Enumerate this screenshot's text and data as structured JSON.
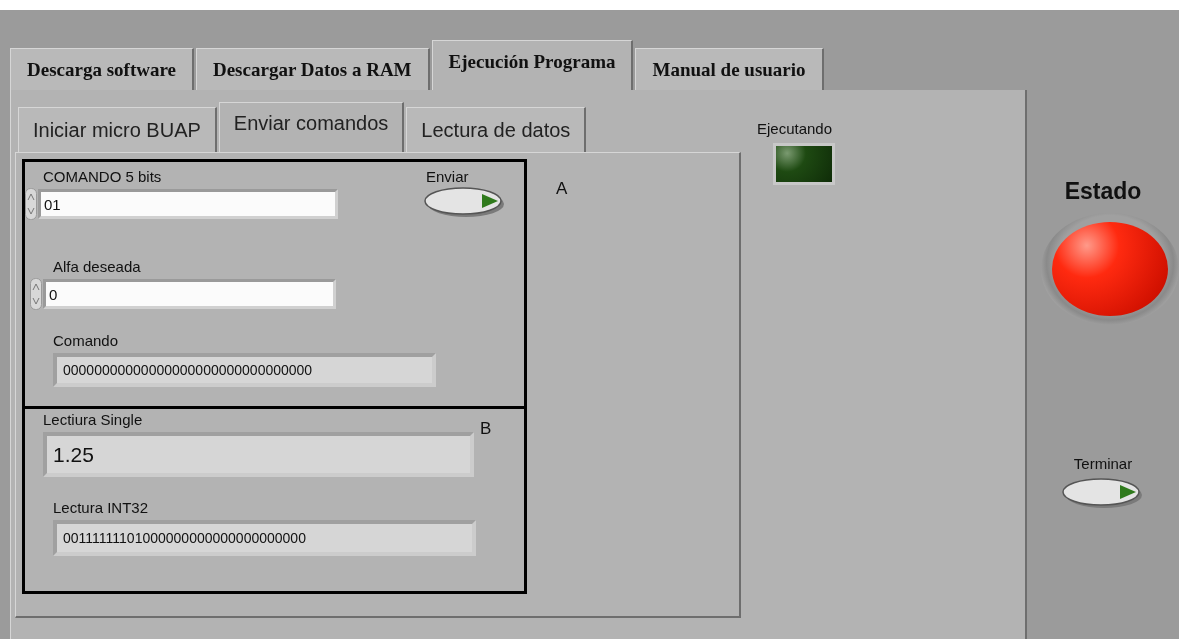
{
  "outer_tabs": [
    {
      "label": "Descarga software",
      "selected": false
    },
    {
      "label": "Descargar Datos a RAM",
      "selected": false
    },
    {
      "label": "Ejecución Programa",
      "selected": true
    },
    {
      "label": "Manual de usuario",
      "selected": false
    }
  ],
  "inner_tabs": [
    {
      "label": "Iniciar micro BUAP",
      "selected": false
    },
    {
      "label": "Enviar comandos",
      "selected": true
    },
    {
      "label": "Lectura de datos",
      "selected": false
    }
  ],
  "section_a": {
    "marker": "A",
    "comando_5_bits": {
      "label": "COMANDO 5 bits",
      "value": "01"
    },
    "enviar": {
      "label": "Enviar",
      "on": false
    },
    "alfa_deseada": {
      "label": "Alfa deseada",
      "value": "0"
    },
    "comando": {
      "label": "Comando",
      "value": "00000000000000000000000000000000"
    }
  },
  "section_b": {
    "marker": "B",
    "lectura_single": {
      "label": "Lectiura Single",
      "value": "1.25"
    },
    "lectura_int32": {
      "label": "Lectura INT32",
      "value": "00111111101000000000000000000000"
    }
  },
  "ejecutando": {
    "label": "Ejecutando",
    "on": false
  },
  "estado": {
    "label": "Estado",
    "on": true
  },
  "terminar": {
    "label": "Terminar",
    "on": false
  }
}
